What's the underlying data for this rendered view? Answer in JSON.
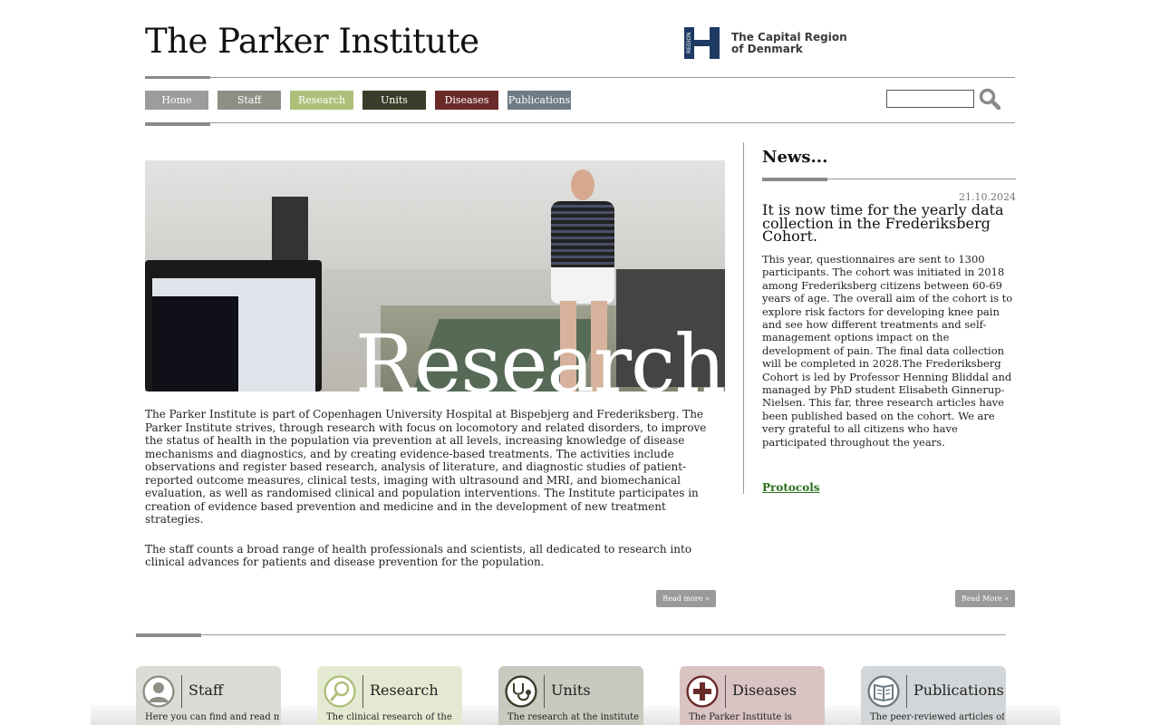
{
  "header": {
    "site_title": "The Parker Institute",
    "region_logo_mark": "REGION",
    "region_logo_text_line1": "The Capital Region",
    "region_logo_text_line2": "of Denmark"
  },
  "nav": [
    {
      "label": "Home",
      "color": "#9c9c9c"
    },
    {
      "label": "Staff",
      "color": "#8f8f85"
    },
    {
      "label": "Research",
      "color": "#aebf7a"
    },
    {
      "label": "Units",
      "color": "#3b3d2a"
    },
    {
      "label": "Diseases",
      "color": "#6b2a2a"
    },
    {
      "label": "Publications",
      "color": "#6f7b84"
    }
  ],
  "search": {
    "placeholder": "",
    "icon": "search-icon"
  },
  "hero": {
    "word": "Research"
  },
  "intro": {
    "paragraph1": "The Parker Institute is part of Copenhagen University Hospital at Bispebjerg and Frederiksberg. The Parker Institute strives, through research with focus on locomotory and related disorders, to improve the status of health in the population via prevention at all levels, increasing knowledge of disease mechanisms and diagnostics, and by creating evidence-based treatments. The activities include observations and register based research, analysis of literature, and diagnostic studies of patient-reported outcome measures, clinical tests, imaging with ultrasound and MRI, and biomechanical evaluation, as well as randomised clinical and population interventions. The Institute participates in creation of evidence based prevention and medicine and in the development of new treatment strategies.",
    "paragraph2": "The staff counts a broad range of health professionals and scientists, all dedicated to research into clinical advances for patients and disease prevention for the population.",
    "read_more": "Read more »"
  },
  "news": {
    "heading": "News...",
    "date": "21.10.2024",
    "title": "It is now time for the yearly data collection in the Frederiksberg Cohort.",
    "body": "This year, questionnaires are sent to 1300 participants. The cohort was initiated in 2018 among Frederiksberg citizens between 60-69 years of age. The overall aim of the cohort is to explore risk factors for developing knee pain and see how different treatments and self-management options impact on the development of pain. The final data collection will be completed in 2028.The Frederiksberg Cohort is led by Professor Henning Bliddal and managed by PhD student Elisabeth Ginnerup-Nielsen. This far, three research articles have been published based on the cohort. We are very grateful to all citizens who have participated throughout the years.",
    "link": "Protocols",
    "read_more": "Read More »"
  },
  "cards": [
    {
      "title": "Staff",
      "desc": "Here you can find and read more",
      "bg": "#dcdcd6",
      "icon": "person-icon",
      "accent": "#8f8f85"
    },
    {
      "title": "Research",
      "desc": "The clinical research of the",
      "bg": "#e4ead2",
      "icon": "magnifier-icon",
      "accent": "#aebf7a"
    },
    {
      "title": "Units",
      "desc": "The research at the institute is",
      "bg": "#c9c9bf",
      "icon": "stethoscope-icon",
      "accent": "#3b3d2a"
    },
    {
      "title": "Diseases",
      "desc": "The Parker Institute is",
      "bg": "#d9c3c3",
      "icon": "medical-cross-icon",
      "accent": "#6b2a2a"
    },
    {
      "title": "Publications",
      "desc": "The peer-reviewed articles of the",
      "bg": "#d3d6d8",
      "icon": "book-icon",
      "accent": "#6f7b84"
    }
  ]
}
